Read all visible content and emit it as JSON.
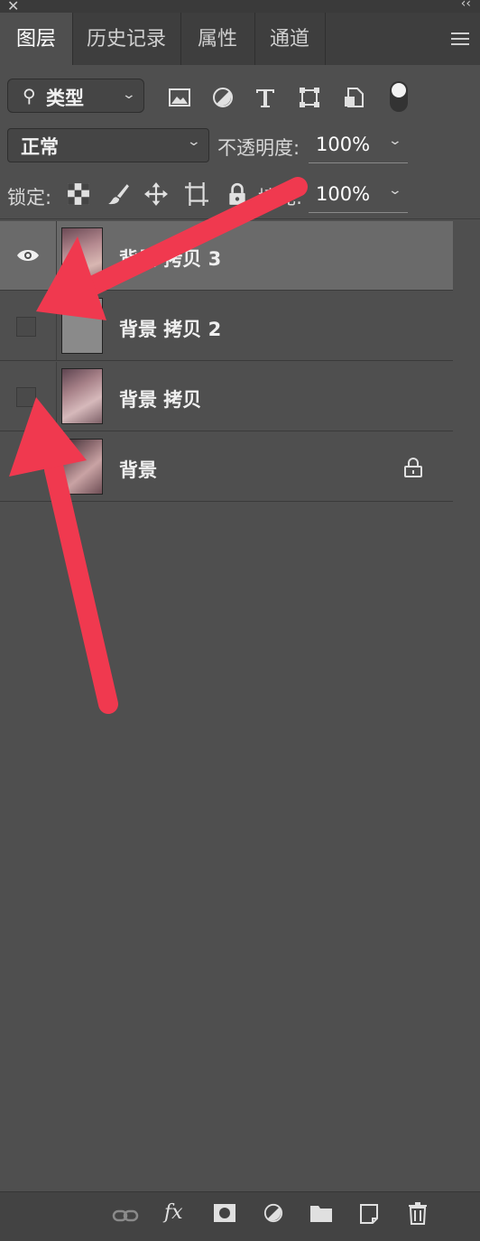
{
  "tabs": [
    {
      "label": "图层"
    },
    {
      "label": "历史记录"
    },
    {
      "label": "属性"
    },
    {
      "label": "通道"
    }
  ],
  "filter": {
    "kind_label": "类型"
  },
  "blend": {
    "mode": "正常",
    "opacity_label": "不透明度:",
    "opacity_value": "100%"
  },
  "lock": {
    "label": "锁定:",
    "fill_label": "填充:",
    "fill_value": "100%"
  },
  "layers": [
    {
      "name": "背景 拷贝 3",
      "visible": true,
      "selected": true
    },
    {
      "name": "背景 拷贝 2",
      "visible": false,
      "selected": false
    },
    {
      "name": "背景 拷贝",
      "visible": false,
      "selected": false
    },
    {
      "name": "背景",
      "visible": true,
      "locked": true,
      "selected": false
    }
  ],
  "colors": {
    "annotation_arrow": "#f0394f",
    "panel_bg": "#4f4f4f",
    "selected_layer": "#6a6a6a"
  }
}
